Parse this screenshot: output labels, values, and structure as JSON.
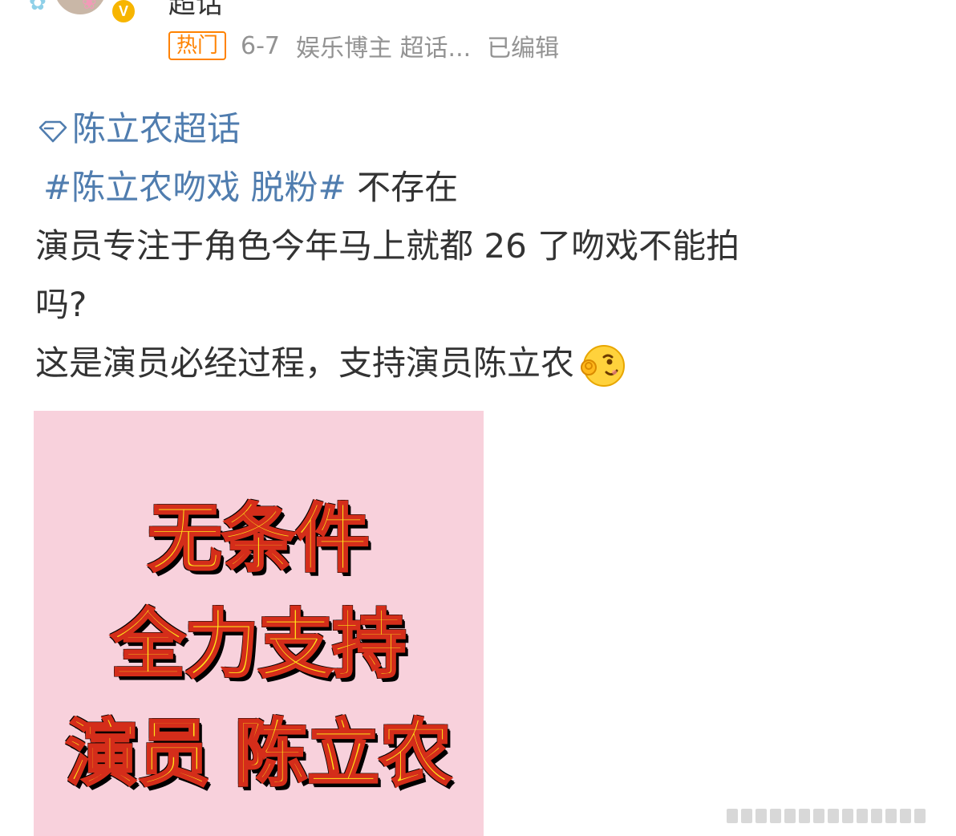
{
  "header": {
    "username": "超话",
    "verified_badge": "V",
    "avatar_decorations": [
      "bow-pendant",
      "pink-flower"
    ],
    "hot_badge": "热门",
    "date": "6-7",
    "category": "娱乐博主",
    "source": "超话...",
    "edited_label": "已编辑"
  },
  "post": {
    "super_topic_icon": "diamond-icon",
    "super_topic": "陈立农超话",
    "hashtag": "#陈立农吻戏 脱粉#",
    "hashtag_suffix": " 不存在",
    "line_3": "演员专注于角色今年马上就都 26 了吻戏不能拍",
    "line_4": "吗?",
    "line_5": "这是演员必经过程，支持演员陈立农",
    "emoji": "wink-ok-emoji"
  },
  "image": {
    "line_1": "无条件",
    "line_2": "全力支持",
    "line_3": "演员 陈立农",
    "background_color": "#f8d1dc",
    "text_fill_color": "#ffe419",
    "text_stroke_color": "#d42d1a"
  },
  "colors": {
    "link": "#507daf",
    "hot_badge": "#ff8200",
    "meta_text": "#939393",
    "body_text": "#333333"
  }
}
